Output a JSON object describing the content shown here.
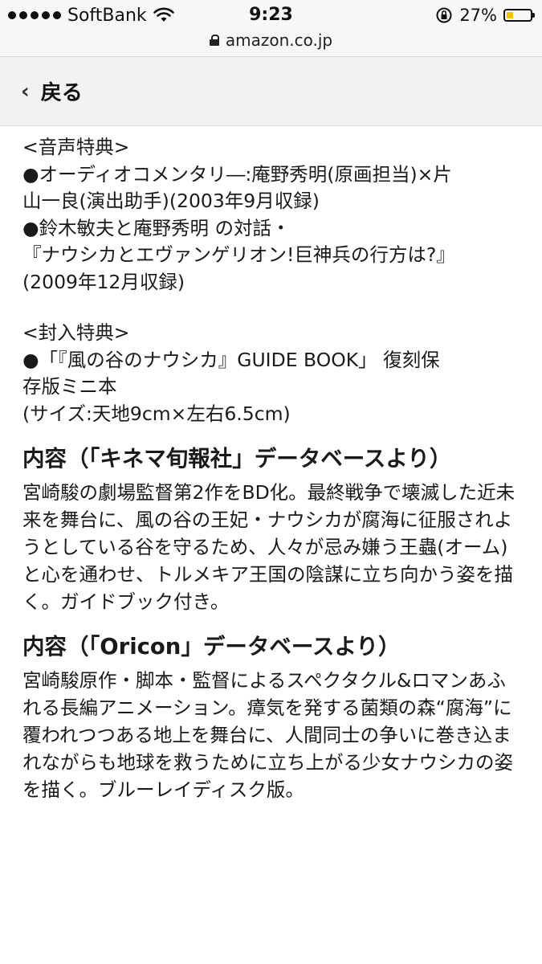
{
  "status_bar": {
    "carrier": "SoftBank",
    "time": "9:23",
    "battery_percent": "27%",
    "battery_level": 0.27,
    "url": "amazon.co.jp"
  },
  "nav": {
    "back_label": "戻る"
  },
  "content": {
    "audio_bonus": {
      "heading": "<音声特典>",
      "line1": "●オーディオコメンタリ―:庵野秀明(原画担当)×片\n山一良(演出助手)(2003年9月収録)",
      "line2": "●鈴木敏夫と庵野秀明 の対話・\n『ナウシカとエヴァンゲリオン!巨神兵の行方は?』\n(2009年12月収録)"
    },
    "enclosed_bonus": {
      "heading": "<封入特典>",
      "line1": "●「『風の谷のナウシカ』GUIDE BOOK」 復刻保\n存版ミニ本",
      "line2": "(サイズ:天地9cm×左右6.5cm)"
    },
    "kinema": {
      "title": "内容（「キネマ旬報社」データベースより）",
      "body": "宮崎駿の劇場監督第2作をBD化。最終戦争で壊滅した近未来を舞台に、風の谷の王妃・ナウシカが腐海に征服されようとしている谷を守るため、人々が忌み嫌う王蟲(オーム)と心を通わせ、トルメキア王国の陰謀に立ち向かう姿を描く。ガイドブック付き。"
    },
    "oricon": {
      "title": "内容（「Oricon」データベースより）",
      "body": "宮崎駿原作・脚本・監督によるスペクタクル&ロマンあふれる長編アニメーション。瘴気を発する菌類の森“腐海”に覆われつつある地上を舞台に、人間同士の争いに巻き込まれながらも地球を救うために立ち上がる少女ナウシカの姿を描く。ブルーレイディスク版。"
    }
  }
}
